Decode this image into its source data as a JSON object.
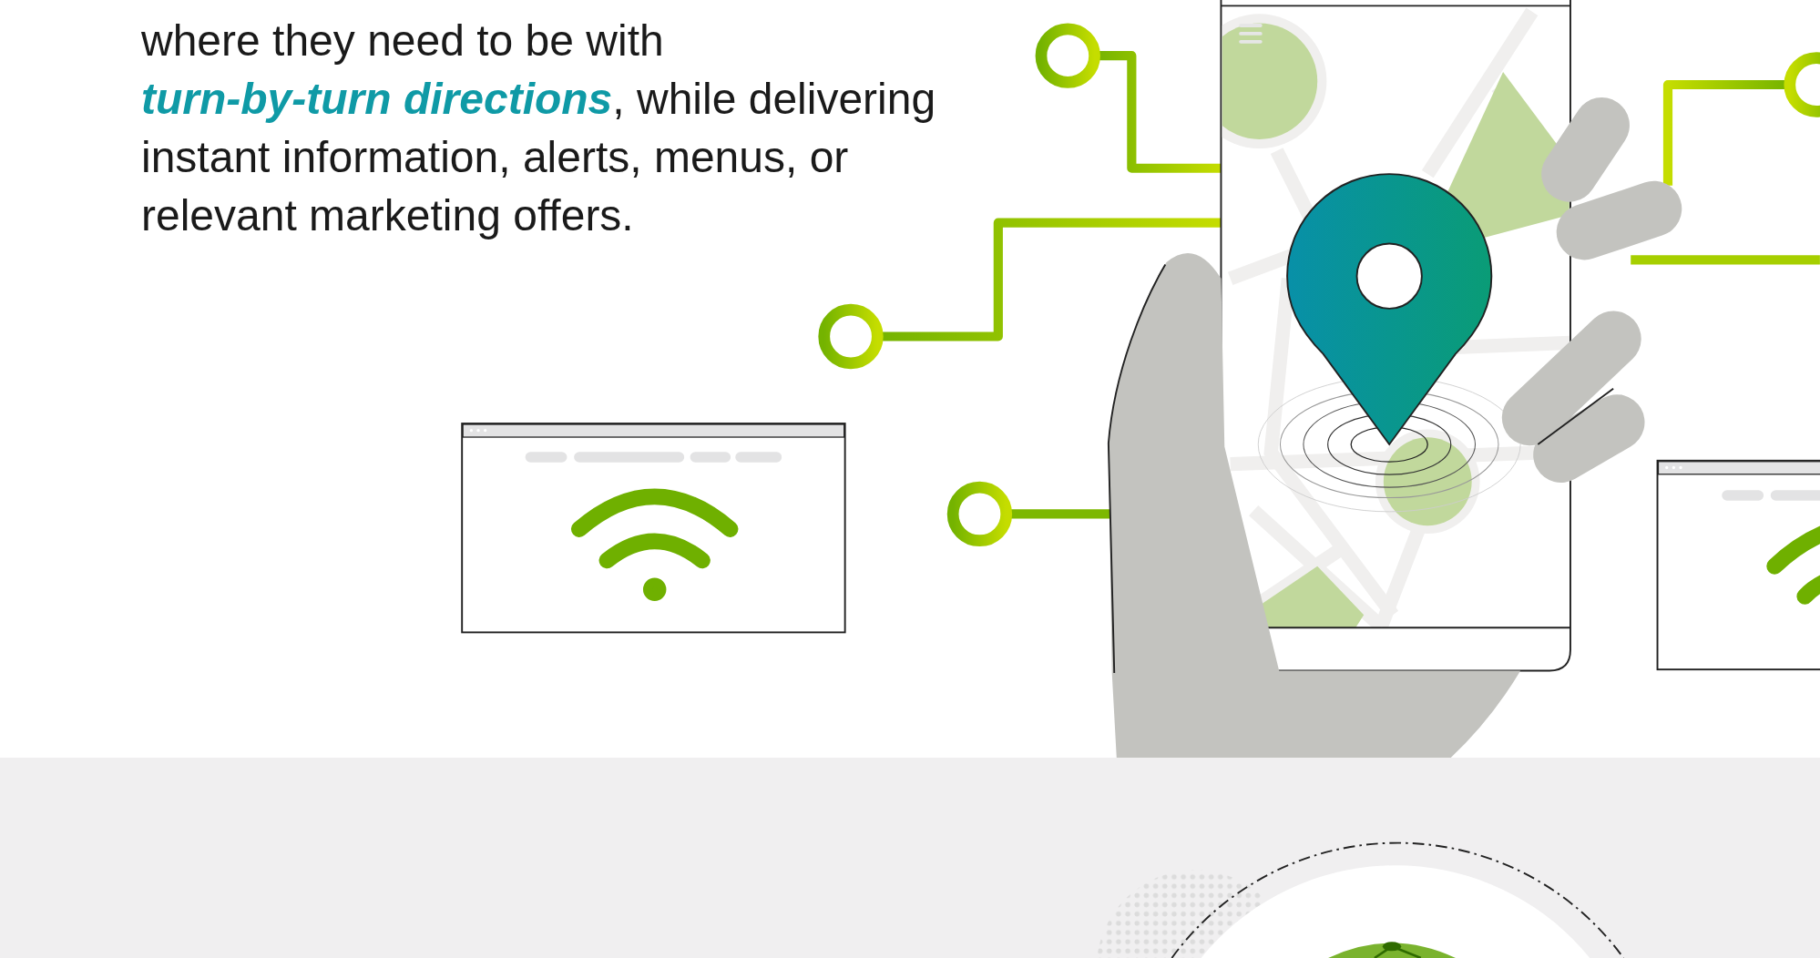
{
  "paragraph": {
    "lines": [
      [
        {
          "kind": "plain",
          "text": "where they need to be with"
        }
      ],
      [
        {
          "kind": "highlight",
          "text": "turn-by-turn directions"
        },
        {
          "kind": "plain",
          "text": ", while delivering"
        }
      ],
      [
        {
          "kind": "plain",
          "text": "instant information, alerts, menus, or"
        }
      ],
      [
        {
          "kind": "plain",
          "text": "relevant marketing offers."
        }
      ]
    ]
  }
}
